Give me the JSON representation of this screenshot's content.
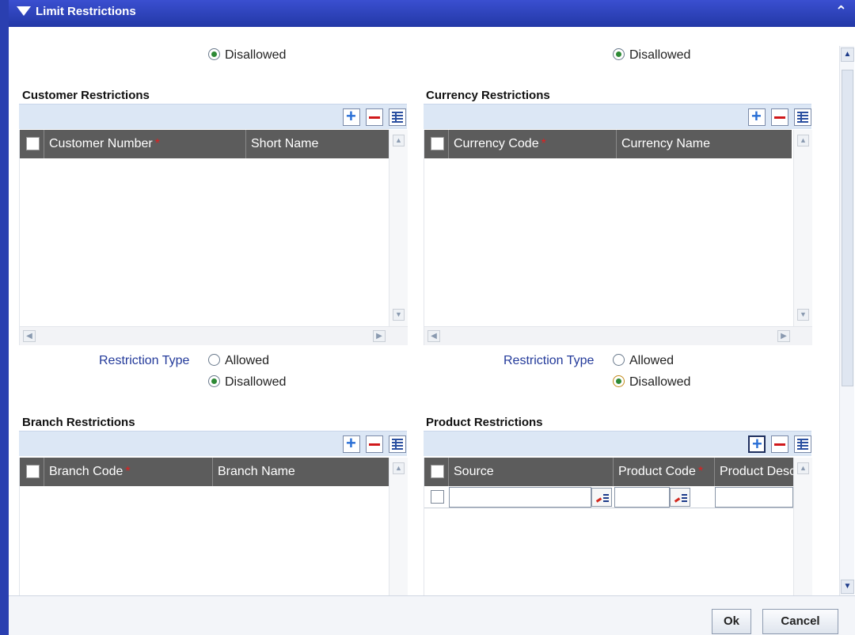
{
  "window": {
    "title": "Limit Restrictions"
  },
  "top_options": {
    "left": "Disallowed",
    "right": "Disallowed"
  },
  "customer": {
    "title": "Customer Restrictions",
    "columns": [
      "Customer Number",
      "Short Name"
    ],
    "required_mark": "*",
    "restriction_type_label": "Restriction Type",
    "options": [
      "Allowed",
      "Disallowed"
    ],
    "selected": "Disallowed"
  },
  "currency": {
    "title": "Currency Restrictions",
    "columns": [
      "Currency Code",
      "Currency Name"
    ],
    "required_mark": "*",
    "restriction_type_label": "Restriction Type",
    "options": [
      "Allowed",
      "Disallowed"
    ],
    "selected": "Disallowed"
  },
  "branch": {
    "title": "Branch Restrictions",
    "columns": [
      "Branch Code",
      "Branch Name"
    ],
    "required_mark": "*"
  },
  "product": {
    "title": "Product Restrictions",
    "columns": [
      "Source",
      "Product Code",
      "Product Desc"
    ],
    "required_mark": "*"
  },
  "footer": {
    "ok_label": "Ok",
    "cancel_label": "Cancel"
  }
}
